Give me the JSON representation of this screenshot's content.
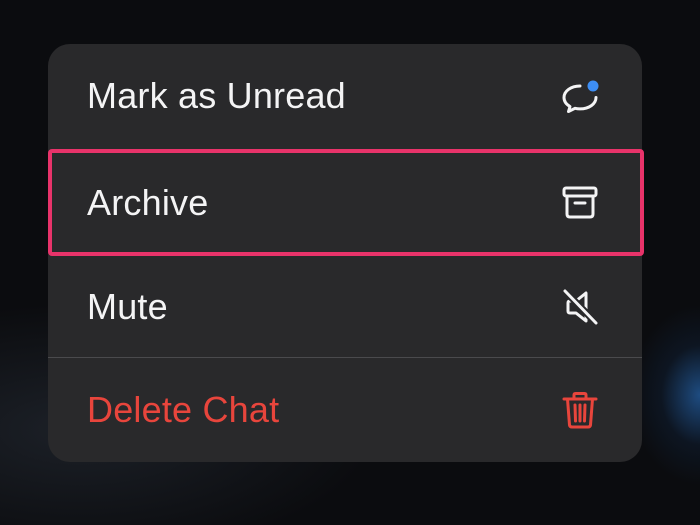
{
  "menu": {
    "items": [
      {
        "label": "Mark as Unread",
        "icon": "chat-bubble-unread-icon",
        "color": "#f4f4f5"
      },
      {
        "label": "Archive",
        "icon": "archive-box-icon",
        "color": "#f4f4f5",
        "highlighted": true
      },
      {
        "label": "Mute",
        "icon": "speaker-muted-icon",
        "color": "#f4f4f5"
      },
      {
        "label": "Delete Chat",
        "icon": "trash-icon",
        "color": "#e8453c"
      }
    ],
    "highlight_color": "#e8336a",
    "unread_dot_color": "#3d8ef5",
    "background_color": "#29292b"
  }
}
